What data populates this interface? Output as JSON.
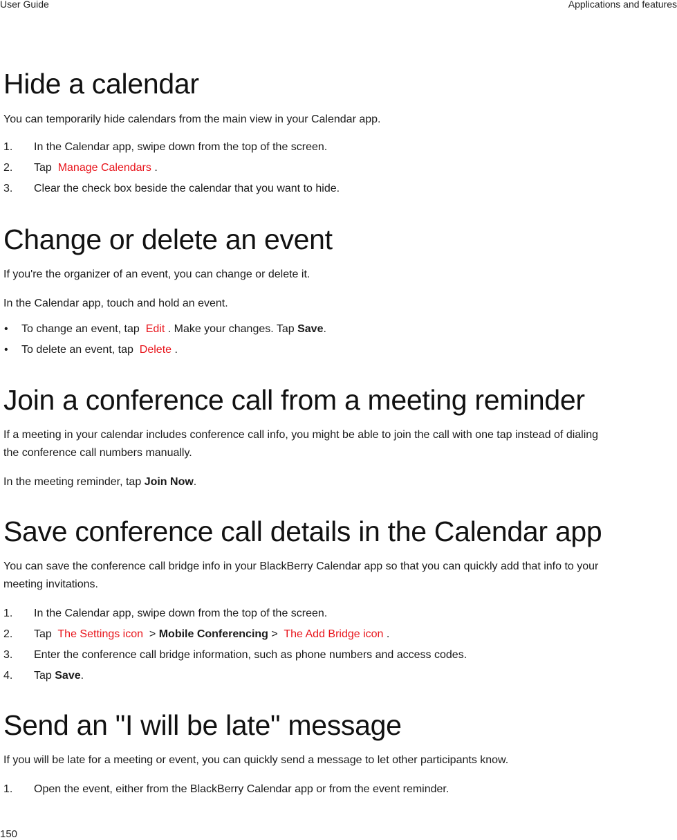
{
  "header": {
    "left": "User Guide",
    "right": "Applications and features"
  },
  "footer": {
    "page_number": "150"
  },
  "colors": {
    "ui_link_red": "#e8141b",
    "text": "#1a1a1a"
  },
  "sections": {
    "hide_calendar": {
      "title": "Hide a calendar",
      "intro": "You can temporarily hide calendars from the main view in your Calendar app.",
      "steps": [
        {
          "num": "1.",
          "text": "In the Calendar app, swipe down from the top of the screen."
        },
        {
          "num": "2.",
          "pre": "Tap",
          "link": "Manage Calendars",
          "post": "."
        },
        {
          "num": "3.",
          "text": "Clear the check box beside the calendar that you want to hide."
        }
      ]
    },
    "change_event": {
      "title": "Change or delete an event",
      "intro": "If you're the organizer of an event, you can change or delete it.",
      "instruction": "In the Calendar app, touch and hold an event.",
      "bullets": [
        {
          "pre": "To change an event, tap",
          "link": "Edit",
          "mid": ". Make your changes. Tap",
          "bold": "Save",
          "post": "."
        },
        {
          "pre": "To delete an event, tap",
          "link": "Delete",
          "post": "."
        }
      ]
    },
    "join_call": {
      "title": "Join a conference call from a meeting reminder",
      "intro_line1": "If a meeting in your calendar includes conference call info, you might be able to join the call with one tap instead of dialing",
      "intro_line2": "the conference call numbers manually.",
      "instruction_pre": "In the meeting reminder, tap",
      "instruction_bold": "Join Now",
      "instruction_post": "."
    },
    "save_details": {
      "title": "Save conference call details in the Calendar app",
      "intro_line1": "You can save the conference call bridge info in your BlackBerry Calendar app so that you can quickly add that info to your",
      "intro_line2": "meeting invitations.",
      "steps": [
        {
          "num": "1.",
          "text": "In the Calendar app, swipe down from the top of the screen."
        },
        {
          "num": "2.",
          "pre": "Tap",
          "link1": "The Settings icon",
          "sep1": ">",
          "bold": "Mobile Conferencing",
          "sep2": ">",
          "link2": "The Add Bridge icon",
          "post": "."
        },
        {
          "num": "3.",
          "text": "Enter the conference call bridge information, such as phone numbers and access codes."
        },
        {
          "num": "4.",
          "pre": "Tap",
          "bold": "Save",
          "post": "."
        }
      ]
    },
    "late_message": {
      "title": "Send an \"I will be late\" message",
      "intro": "If you will be late for a meeting or event, you can quickly send a message to let other participants know.",
      "steps": [
        {
          "num": "1.",
          "text": "Open the event, either from the BlackBerry Calendar app or from the event reminder."
        }
      ]
    }
  }
}
